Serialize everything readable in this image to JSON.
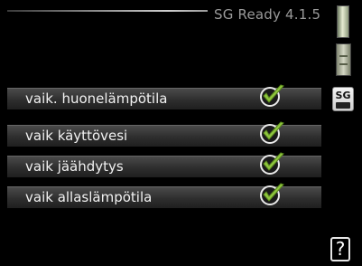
{
  "header": {
    "title": "SG Ready 4.1.5"
  },
  "sg_icon": {
    "label": "SG",
    "icon": "sg-ready-icon"
  },
  "rows": [
    {
      "label": "vaik. huonelämpötila",
      "checked": true
    },
    {
      "label": "vaik käyttövesi",
      "checked": true
    },
    {
      "label": "vaik jäähdytys",
      "checked": true
    },
    {
      "label": "vaik allaslämpötila",
      "checked": true
    }
  ],
  "help": {
    "label": "?"
  },
  "colors": {
    "check_green": "#8fc63f",
    "background": "#000000"
  }
}
